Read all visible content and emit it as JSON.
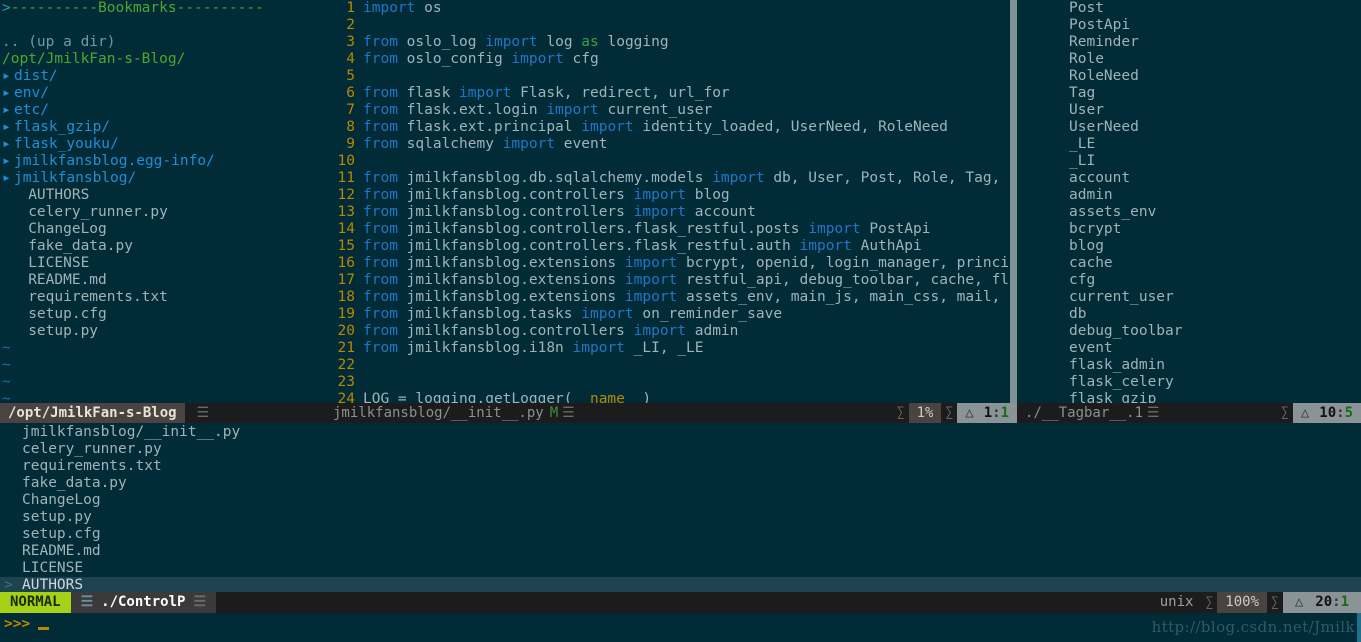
{
  "editor": {
    "mode": "NORMAL",
    "active_buffer_name": "./ControlP",
    "encoding": "unix",
    "percent": "100%",
    "position": "20:1",
    "position_line": "20",
    "position_col": "1",
    "colors": {
      "background": "#012b36",
      "keyword_blue": "#2176c7",
      "keyword_green": "#3f9e3f",
      "line_number": "#b58900",
      "text": "#9eb4ba",
      "directory_blue": "#1f8fd6",
      "mode_green": "#a6d119",
      "split_gray": "#7d9399",
      "selection": "#1d4350"
    }
  },
  "nerdtree": {
    "bookmarks_header": "----------Bookmarks----------",
    "bookmarks_arrow": ">",
    "up_a_dir": ".. (up a dir)",
    "root_path": "/opt/JmilkFan-s-Blog/",
    "directories": [
      "dist/",
      "env/",
      "etc/",
      "flask_gzip/",
      "flask_youku/",
      "jmilkfansblog.egg-info/",
      "jmilkfansblog/"
    ],
    "dir_arrow": "▸",
    "files": [
      "AUTHORS",
      "celery_runner.py",
      "ChangeLog",
      "fake_data.py",
      "LICENSE",
      "README.md",
      "requirements.txt",
      "setup.cfg",
      "setup.py"
    ],
    "empty_marker": "~",
    "empty_line_count": 4,
    "statusline": {
      "name": "/opt/JmilkFan-s-Blog",
      "glyph": "☰"
    }
  },
  "code": {
    "filename": "jmilkfansblog/__init__.py",
    "modified_flag": "M",
    "percent": "1%",
    "position": "1:1",
    "position_line": "1",
    "position_col": "1",
    "glyph": "☰",
    "line_icon": "△",
    "lines": [
      {
        "n": "1",
        "tokens": [
          {
            "t": "import",
            "c": "kw"
          },
          {
            "t": " os",
            "c": "ident"
          }
        ]
      },
      {
        "n": "2",
        "tokens": []
      },
      {
        "n": "3",
        "tokens": [
          {
            "t": "from",
            "c": "kw"
          },
          {
            "t": " oslo_log ",
            "c": "ident"
          },
          {
            "t": "import",
            "c": "kw"
          },
          {
            "t": " log ",
            "c": "ident"
          },
          {
            "t": "as",
            "c": "kw2"
          },
          {
            "t": " logging",
            "c": "ident"
          }
        ]
      },
      {
        "n": "4",
        "tokens": [
          {
            "t": "from",
            "c": "kw"
          },
          {
            "t": " oslo_config ",
            "c": "ident"
          },
          {
            "t": "import",
            "c": "kw"
          },
          {
            "t": " cfg",
            "c": "ident"
          }
        ]
      },
      {
        "n": "5",
        "tokens": []
      },
      {
        "n": "6",
        "tokens": [
          {
            "t": "from",
            "c": "kw"
          },
          {
            "t": " flask ",
            "c": "ident"
          },
          {
            "t": "import",
            "c": "kw"
          },
          {
            "t": " Flask, redirect, url_for",
            "c": "ident"
          }
        ]
      },
      {
        "n": "7",
        "tokens": [
          {
            "t": "from",
            "c": "kw"
          },
          {
            "t": " flask.ext.login ",
            "c": "ident"
          },
          {
            "t": "import",
            "c": "kw"
          },
          {
            "t": " current_user",
            "c": "ident"
          }
        ]
      },
      {
        "n": "8",
        "tokens": [
          {
            "t": "from",
            "c": "kw"
          },
          {
            "t": " flask.ext.principal ",
            "c": "ident"
          },
          {
            "t": "import",
            "c": "kw"
          },
          {
            "t": " identity_loaded, UserNeed, RoleNeed",
            "c": "ident"
          }
        ]
      },
      {
        "n": "9",
        "tokens": [
          {
            "t": "from",
            "c": "kw"
          },
          {
            "t": " sqlalchemy ",
            "c": "ident"
          },
          {
            "t": "import",
            "c": "kw"
          },
          {
            "t": " event",
            "c": "ident"
          }
        ]
      },
      {
        "n": "10",
        "tokens": []
      },
      {
        "n": "11",
        "tokens": [
          {
            "t": "from",
            "c": "kw"
          },
          {
            "t": " jmilkfansblog.db.sqlalchemy.models ",
            "c": "ident"
          },
          {
            "t": "import",
            "c": "kw"
          },
          {
            "t": " db, User, Post, Role, Tag,",
            "c": "ident"
          }
        ]
      },
      {
        "n": "12",
        "tokens": [
          {
            "t": "from",
            "c": "kw"
          },
          {
            "t": " jmilkfansblog.controllers ",
            "c": "ident"
          },
          {
            "t": "import",
            "c": "kw"
          },
          {
            "t": " blog",
            "c": "ident"
          }
        ]
      },
      {
        "n": "13",
        "tokens": [
          {
            "t": "from",
            "c": "kw"
          },
          {
            "t": " jmilkfansblog.controllers ",
            "c": "ident"
          },
          {
            "t": "import",
            "c": "kw"
          },
          {
            "t": " account",
            "c": "ident"
          }
        ]
      },
      {
        "n": "14",
        "tokens": [
          {
            "t": "from",
            "c": "kw"
          },
          {
            "t": " jmilkfansblog.controllers.flask_restful.posts ",
            "c": "ident"
          },
          {
            "t": "import",
            "c": "kw"
          },
          {
            "t": " PostApi",
            "c": "ident"
          }
        ]
      },
      {
        "n": "15",
        "tokens": [
          {
            "t": "from",
            "c": "kw"
          },
          {
            "t": " jmilkfansblog.controllers.flask_restful.auth ",
            "c": "ident"
          },
          {
            "t": "import",
            "c": "kw"
          },
          {
            "t": " AuthApi",
            "c": "ident"
          }
        ]
      },
      {
        "n": "16",
        "tokens": [
          {
            "t": "from",
            "c": "kw"
          },
          {
            "t": " jmilkfansblog.extensions ",
            "c": "ident"
          },
          {
            "t": "import",
            "c": "kw"
          },
          {
            "t": " bcrypt, openid, login_manager, princi",
            "c": "ident"
          }
        ]
      },
      {
        "n": "17",
        "tokens": [
          {
            "t": "from",
            "c": "kw"
          },
          {
            "t": " jmilkfansblog.extensions ",
            "c": "ident"
          },
          {
            "t": "import",
            "c": "kw"
          },
          {
            "t": " restful_api, debug_toolbar, cache, fl",
            "c": "ident"
          }
        ]
      },
      {
        "n": "18",
        "tokens": [
          {
            "t": "from",
            "c": "kw"
          },
          {
            "t": " jmilkfansblog.extensions ",
            "c": "ident"
          },
          {
            "t": "import",
            "c": "kw"
          },
          {
            "t": " assets_env, main_js, main_css, mail,",
            "c": "ident"
          }
        ]
      },
      {
        "n": "19",
        "tokens": [
          {
            "t": "from",
            "c": "kw"
          },
          {
            "t": " jmilkfansblog.tasks ",
            "c": "ident"
          },
          {
            "t": "import",
            "c": "kw"
          },
          {
            "t": " on_reminder_save",
            "c": "ident"
          }
        ]
      },
      {
        "n": "20",
        "tokens": [
          {
            "t": "from",
            "c": "kw"
          },
          {
            "t": " jmilkfansblog.controllers ",
            "c": "ident"
          },
          {
            "t": "import",
            "c": "kw"
          },
          {
            "t": " admin",
            "c": "ident"
          }
        ]
      },
      {
        "n": "21",
        "tokens": [
          {
            "t": "from",
            "c": "kw"
          },
          {
            "t": " jmilkfansblog.i18n ",
            "c": "ident"
          },
          {
            "t": "import",
            "c": "kw"
          },
          {
            "t": " _LI, _LE",
            "c": "ident"
          }
        ]
      },
      {
        "n": "22",
        "tokens": []
      },
      {
        "n": "23",
        "tokens": []
      },
      {
        "n": "24",
        "tokens": [
          {
            "t": "LOG = logging.getLogger(",
            "c": "ident"
          },
          {
            "t": "__name__",
            "c": "dunder"
          },
          {
            "t": ")",
            "c": "ident"
          }
        ]
      }
    ]
  },
  "tagbar": {
    "items": [
      "Post",
      "PostApi",
      "Reminder",
      "Role",
      "RoleNeed",
      "Tag",
      "User",
      "UserNeed",
      "_LE",
      "_LI",
      "account",
      "admin",
      "assets_env",
      "bcrypt",
      "blog",
      "cache",
      "cfg",
      "current_user",
      "db",
      "debug_toolbar",
      "event",
      "flask_admin",
      "flask_celery",
      "flask_gzip"
    ],
    "statusline": {
      "name": "./__Tagbar__.1",
      "glyph": "☰",
      "line_icon": "△",
      "position": "10:5",
      "position_line": "10",
      "position_col": "5"
    }
  },
  "ctrlp": {
    "results": [
      "jmilkfansblog/__init__.py",
      "celery_runner.py",
      "requirements.txt",
      "fake_data.py",
      "ChangeLog",
      "setup.py",
      "setup.cfg",
      "README.md",
      "LICENSE",
      "AUTHORS"
    ],
    "selected_index": 9,
    "selection_marker": ">"
  },
  "terminal": {
    "prompt": ">>>",
    "watermark": "http://blog.csdn.net/Jmilk"
  }
}
